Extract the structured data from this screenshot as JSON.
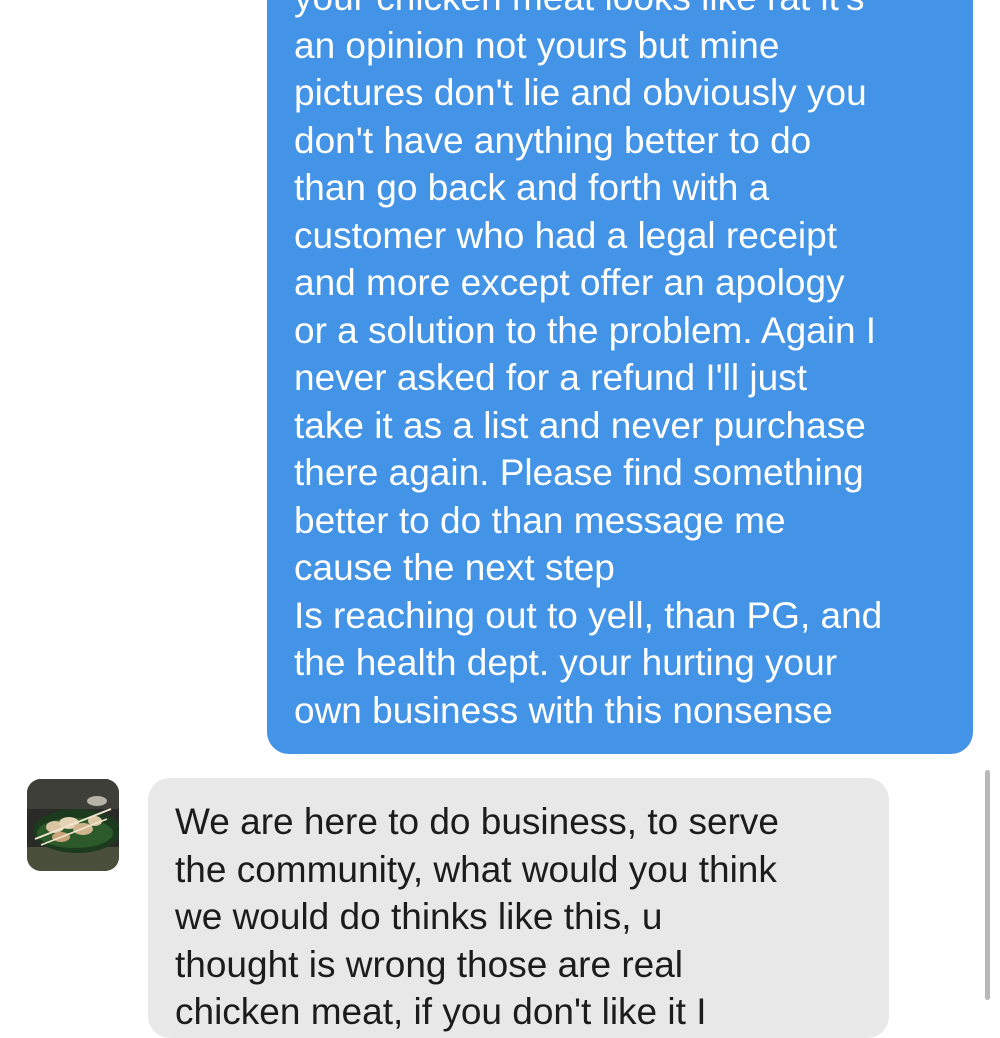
{
  "conversation": {
    "sent_message": {
      "lines": [
        "your chicken meat looks like rat it's",
        "an opinion not yours but mine",
        "pictures don't lie and obviously you",
        "don't have anything better to do",
        "than go back and forth with a",
        "customer who had a legal receipt",
        "and more except offer an apology",
        "or a solution to the problem. Again I",
        "never asked for a refund I'll just",
        "take it as a list and never purchase",
        "there again. Please find something",
        "better to do than message me",
        "cause the next step",
        "Is reaching out to yell, than PG, and",
        "the health dept. your hurting your",
        "own business with this nonsense"
      ]
    },
    "received_message": {
      "avatar_icon": "food-photo-avatar-icon",
      "lines": [
        "We are here to do business, to serve",
        "the community, what would you think",
        "we would do thinks like this, u",
        "thought is wrong those are real",
        "chicken meat, if you don't like it I"
      ]
    }
  },
  "colors": {
    "sent_bubble": "#4393E6",
    "received_bubble": "#E8E8E8",
    "sent_text": "#ffffff",
    "received_text": "#1c1c1c"
  }
}
